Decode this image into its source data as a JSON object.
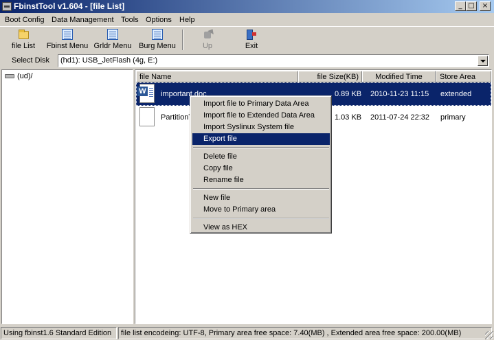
{
  "window": {
    "title": "FbinstTool v1.604 - [file List]"
  },
  "title_buttons": {
    "minimize": "_",
    "maximize": "□",
    "close": "×"
  },
  "menu": [
    "Boot Config",
    "Data Management",
    "Tools",
    "Options",
    "Help"
  ],
  "toolbar": {
    "file_list": "file List",
    "fbinst_menu": "Fbinst Menu",
    "grldr_menu": "Grldr Menu",
    "burg_menu": "Burg Menu",
    "up": "Up",
    "exit": "Exit"
  },
  "disk": {
    "label": "Select Disk",
    "value": "(hd1): USB_JetFlash (4g, E:)"
  },
  "tree": {
    "root": "(ud)/"
  },
  "columns": {
    "name": "file Name",
    "size": "file Size(KB)",
    "modified": "Modified Time",
    "area": "Store Area"
  },
  "files": [
    {
      "name": "important.doc",
      "size": "0.89 KB",
      "modified": "2010-11-23 11:15",
      "area": "extended",
      "icon": "word-document-icon"
    },
    {
      "name": "PartitionT",
      "size": "1.03 KB",
      "modified": "2011-07-24 22:32",
      "area": "primary",
      "icon": "blank-file-icon"
    }
  ],
  "context_menu": {
    "import_primary": "Import file to Primary Data Area",
    "import_extended": "Import file to Extended Data Area",
    "import_syslinux": "Import Syslinux System file",
    "export": "Export file",
    "delete": "Delete file",
    "copy": "Copy file",
    "rename": "Rename file",
    "new": "New file",
    "move_primary": "Move to Primary area",
    "view_hex": "View as HEX"
  },
  "status": {
    "edition": "Using fbinst1.6 Standard Edition",
    "info": "file list encodeing: UTF-8, Primary area free space: 7.40(MB) ,  Extended area free space: 200.00(MB)"
  },
  "colors": {
    "selection": "#0a246a",
    "face": "#d4d0c8",
    "title_start": "#0a246a",
    "title_end": "#a6caf0"
  }
}
